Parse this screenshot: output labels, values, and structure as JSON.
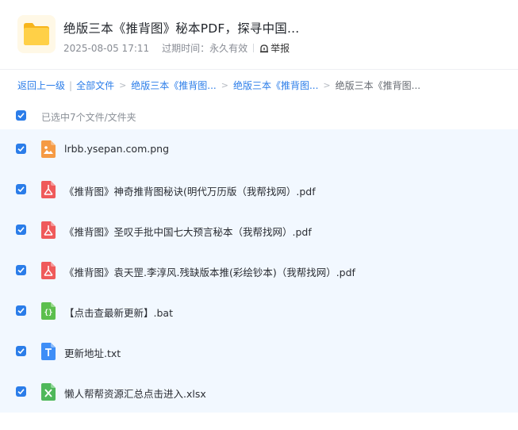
{
  "header": {
    "title": "绝版三本《推背图》秘本PDF，探寻中国...",
    "date": "2025-08-05 17:11",
    "expire_label": "过期时间：永久有效",
    "report_label": "举报",
    "folder_icon": "folder-icon"
  },
  "breadcrumb": {
    "back": "返回上一级",
    "all_files": "全部文件",
    "level1": "绝版三本《推背图...",
    "level2": "绝版三本《推背图...",
    "current": "绝版三本《推背图..."
  },
  "selection": {
    "label": "已选中7个文件/文件夹",
    "checked": true
  },
  "files": [
    {
      "name": "lrbb.ysepan.com.png",
      "type": "image",
      "color": "#f59a44",
      "checked": true
    },
    {
      "name": "《推背图》神奇推背图秘诀(明代万历版（我帮找网）.pdf",
      "type": "pdf",
      "color": "#ef5a5a",
      "checked": true
    },
    {
      "name": "《推背图》圣叹手批中国七大预言秘本（我帮找网）.pdf",
      "type": "pdf",
      "color": "#ef5a5a",
      "checked": true
    },
    {
      "name": "《推背图》袁天罡.李淳风.残缺版本推(彩绘钞本)（我帮找网）.pdf",
      "type": "pdf",
      "color": "#ef5a5a",
      "checked": true
    },
    {
      "name": "【点击查最新更新】.bat",
      "type": "code",
      "color": "#5cbf4d",
      "checked": true
    },
    {
      "name": "更新地址.txt",
      "type": "text",
      "color": "#3e8ef7",
      "checked": true
    },
    {
      "name": "懒人帮帮资源汇总点击进入.xlsx",
      "type": "excel",
      "color": "#4fb85a",
      "checked": true
    }
  ],
  "colors": {
    "accent": "#2b7de9",
    "list_bg": "#f2f8ff"
  }
}
